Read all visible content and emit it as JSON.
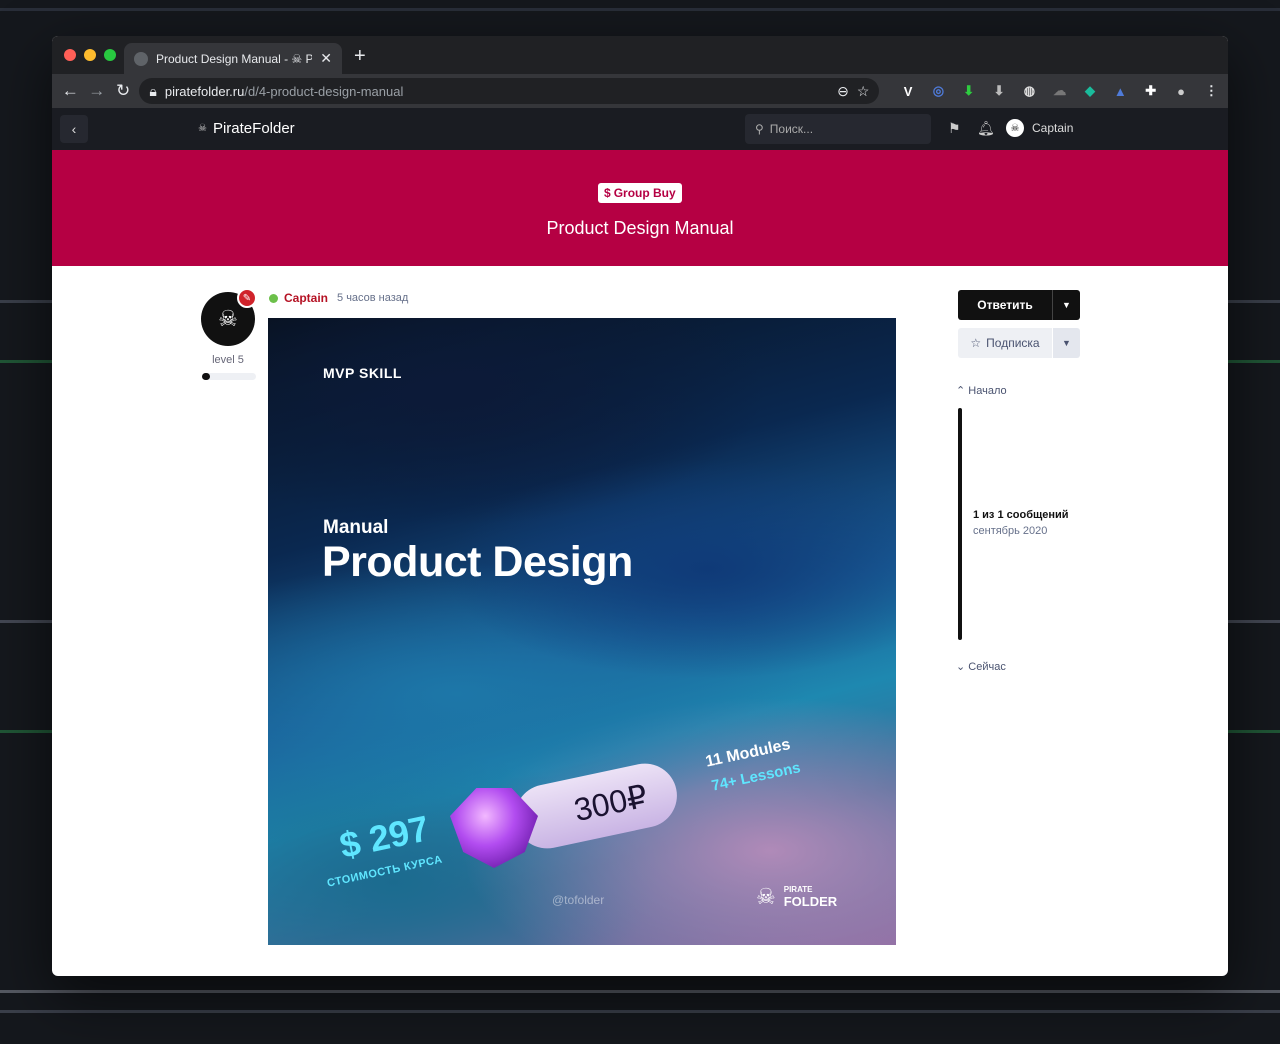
{
  "colors": {
    "brand": "#b50043",
    "author": "#b51224",
    "online": "#6cc04a",
    "header_bg": "#1a1c22"
  },
  "browser": {
    "tab_title": "Product Design Manual - ☠ Pi",
    "url_host": "piratefolder.ru",
    "url_path": "/d/4-product-design-manual"
  },
  "site": {
    "logo_text": "PirateFolder",
    "search_placeholder": "Поиск...",
    "user_name": "Captain"
  },
  "discussion": {
    "tag": "Group Buy",
    "title": "Product Design Manual"
  },
  "post": {
    "author": "Captain",
    "time": "5 часов назад",
    "level_label": "level 5",
    "level_progress": 0.1,
    "image": {
      "brand": "MVP SKILL",
      "subtitle": "Manual",
      "title": "Product Design",
      "modules": "11 Modules",
      "lessons": "74+ Lessons",
      "price_rub": "300₽",
      "price_usd": "$ 297",
      "cost_label": "СТОИМОСТЬ КУРСА",
      "handle": "@tofolder",
      "logo_line1": "PIRATE",
      "logo_line2": "FOLDER"
    }
  },
  "sidebar": {
    "reply_label": "Ответить",
    "subscribe_label": "Подписка",
    "scrub_start": "Начало",
    "scrub_count": "1 из 1 сообщений",
    "scrub_date": "сентябрь 2020",
    "scrub_now": "Сейчас"
  }
}
